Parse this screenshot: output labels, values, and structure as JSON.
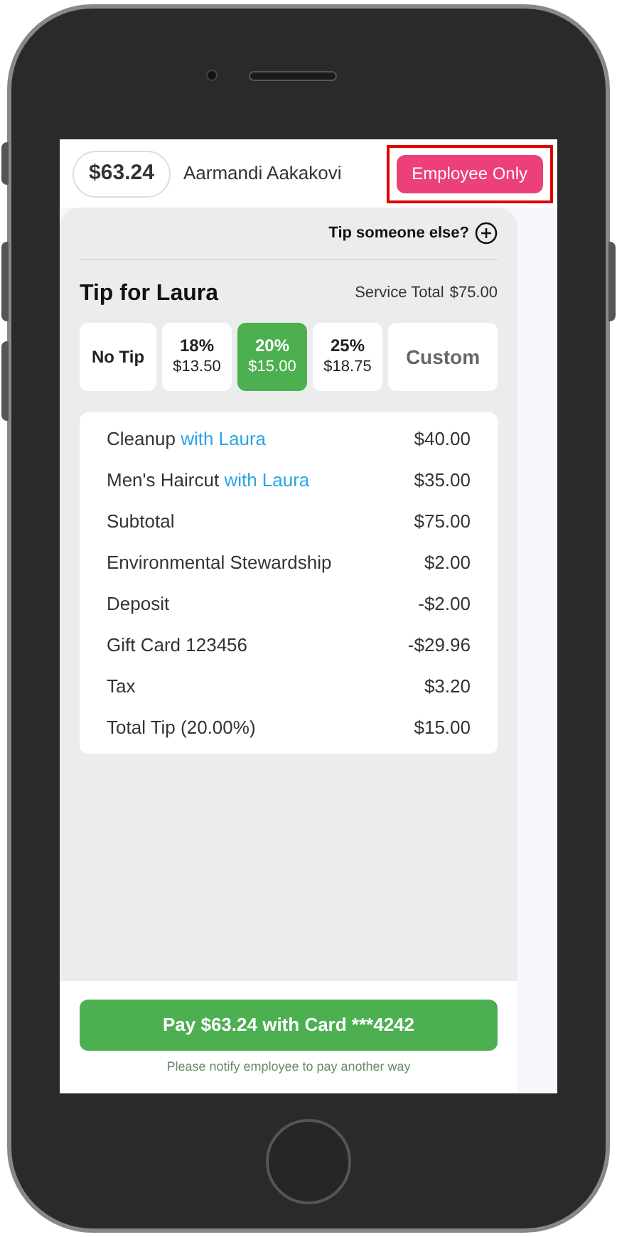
{
  "header": {
    "amount": "$63.24",
    "customer": "Aarmandi Aakakovi",
    "employee_button": "Employee Only"
  },
  "tip_someone_else": "Tip someone else?",
  "tip_title": "Tip for Laura",
  "service_total_label": "Service Total",
  "service_total": "$75.00",
  "tip_options": [
    {
      "kind": "plain",
      "label": "No Tip",
      "selected": false
    },
    {
      "kind": "percent",
      "label": "18%",
      "amount": "$13.50",
      "selected": false
    },
    {
      "kind": "percent",
      "label": "20%",
      "amount": "$15.00",
      "selected": true
    },
    {
      "kind": "percent",
      "label": "25%",
      "amount": "$18.75",
      "selected": false
    },
    {
      "kind": "custom",
      "label": "Custom",
      "selected": false
    }
  ],
  "line_items": [
    {
      "label": "Cleanup",
      "provider": "with Laura",
      "amount": "$40.00"
    },
    {
      "label": "Men's Haircut",
      "provider": "with Laura",
      "amount": "$35.00"
    },
    {
      "label": "Subtotal",
      "amount": "$75.00"
    },
    {
      "label": "Environmental Stewardship",
      "amount": "$2.00"
    },
    {
      "label": "Deposit",
      "amount": "-$2.00"
    },
    {
      "label": "Gift Card 123456",
      "amount": "-$29.96"
    },
    {
      "label": "Tax",
      "amount": "$3.20"
    },
    {
      "label": "Total Tip (20.00%)",
      "amount": "$15.00"
    }
  ],
  "pay_button": "Pay $63.24 with Card ***4242",
  "pay_note": "Please notify employee to pay another way"
}
